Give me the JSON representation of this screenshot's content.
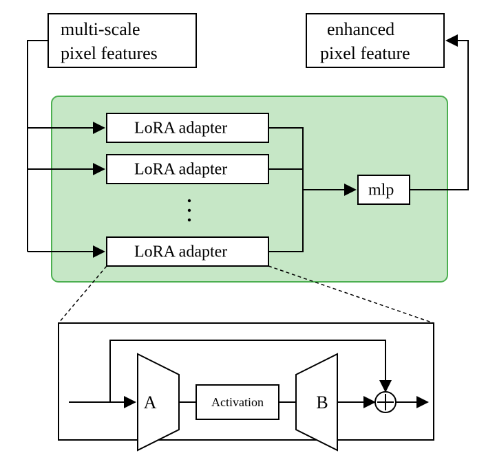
{
  "top": {
    "input_line1": "multi-scale",
    "input_line2": "pixel features",
    "output_line1": "enhanced",
    "output_line2": "pixel feature"
  },
  "adapters": {
    "item1": "LoRA adapter",
    "item2": "LoRA adapter",
    "item3": "LoRA adapter"
  },
  "fuse": {
    "mlp": "mlp"
  },
  "detail": {
    "A": "A",
    "activation": "Activation",
    "B": "B"
  }
}
